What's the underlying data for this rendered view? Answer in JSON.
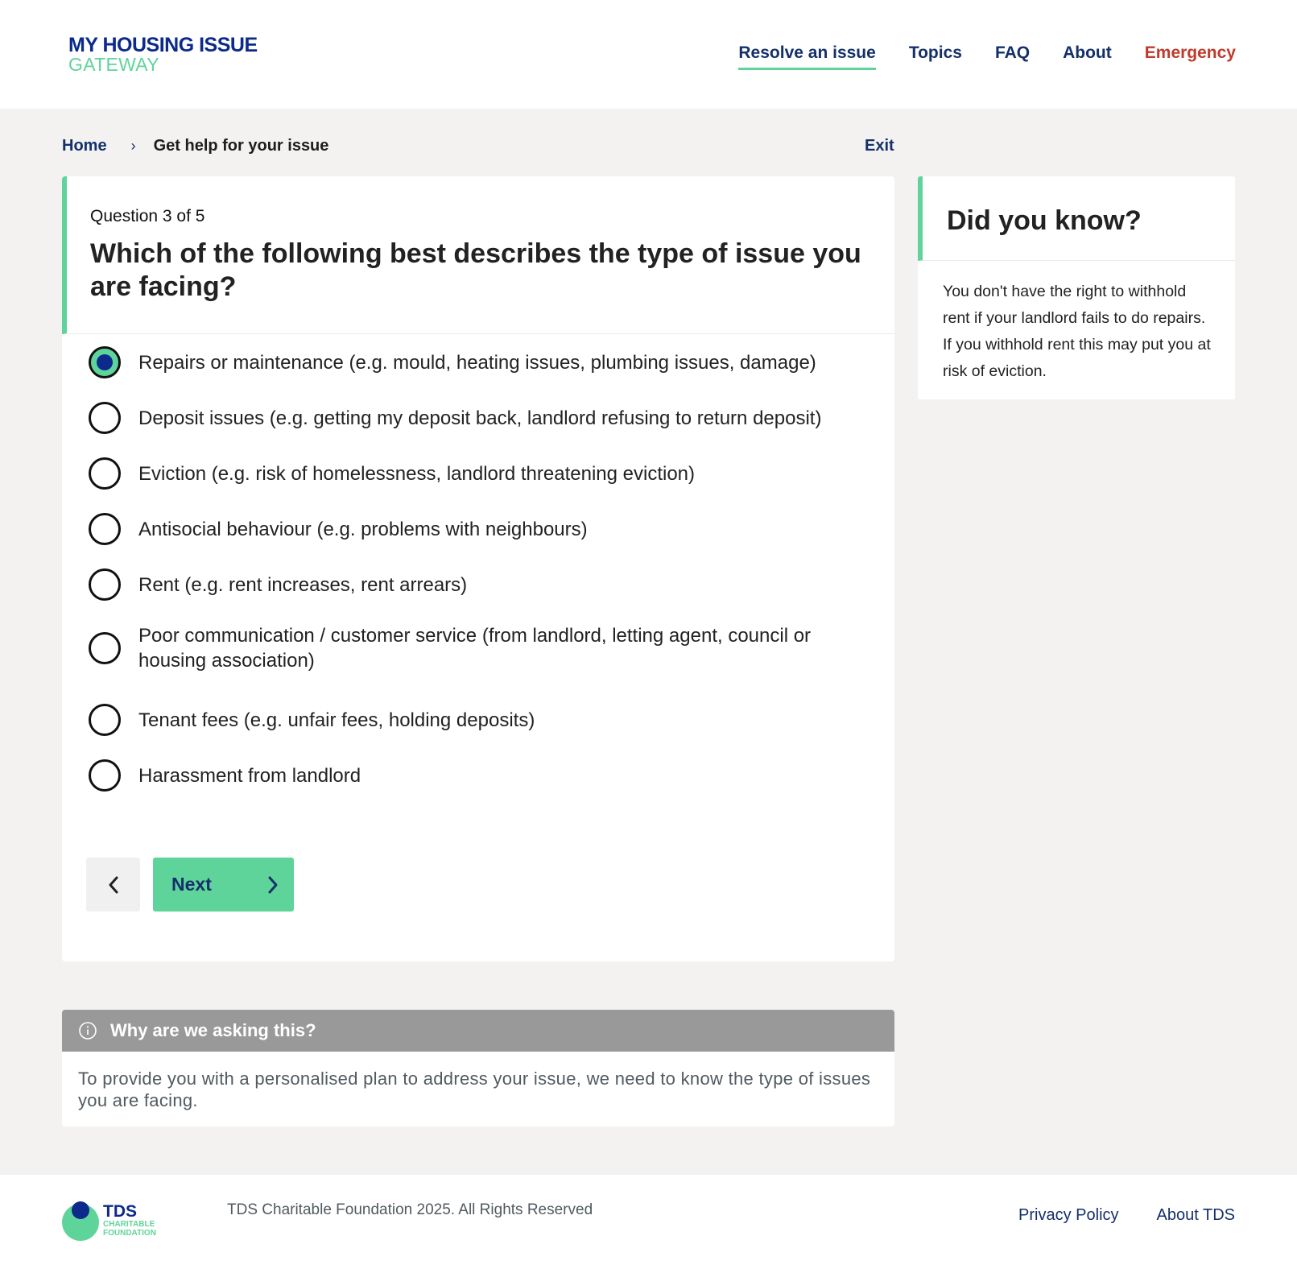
{
  "header": {
    "logo_line1": "MY HOUSING ISSUE",
    "logo_line2": "GATEWAY",
    "nav": [
      {
        "label": "Resolve an issue",
        "active": true
      },
      {
        "label": "Topics"
      },
      {
        "label": "FAQ"
      },
      {
        "label": "About"
      },
      {
        "label": "Emergency"
      }
    ]
  },
  "breadcrumb": {
    "home": "Home",
    "current": "Get help for your issue",
    "exit": "Exit"
  },
  "question": {
    "counter": "Question 3 of 5",
    "title": "Which of the following best describes the type of issue you are facing?",
    "selected_index": 0,
    "options": [
      "Repairs or maintenance (e.g. mould, heating issues, plumbing issues, damage)",
      "Deposit issues (e.g. getting my deposit back, landlord refusing to return deposit)",
      "Eviction (e.g. risk of homelessness, landlord threatening eviction)",
      "Antisocial behaviour (e.g. problems with neighbours)",
      "Rent (e.g. rent increases, rent arrears)",
      "Poor communication / customer service (from landlord, letting agent, council or housing association)",
      "Tenant fees (e.g. unfair fees, holding deposits)",
      "Harassment from landlord"
    ],
    "next_label": "Next",
    "back_icon": "chevron-left-icon",
    "next_icon": "chevron-right-icon"
  },
  "did_you_know": {
    "title": "Did you know?",
    "body": "You don't have the right to withhold rent if your landlord fails to do repairs. If you withhold rent this may put you at risk of eviction."
  },
  "why": {
    "icon": "info-icon",
    "title": "Why are we asking this?",
    "body": "To provide you with a personalised plan to address your issue, we need to know the type of issues you are facing."
  },
  "footer": {
    "logo_text": "TDS",
    "logo_sub1": "CHARITABLE",
    "logo_sub2": "FOUNDATION",
    "copyright": "TDS Charitable Foundation 2025. All Rights Reserved",
    "links": [
      "Privacy Policy",
      "About TDS"
    ]
  },
  "colors": {
    "brand_navy": "#0b2a8c",
    "brand_green": "#5fd49a",
    "link_navy": "#13306a",
    "emergency_red": "#c0392b",
    "page_bg": "#f3f2f1"
  }
}
